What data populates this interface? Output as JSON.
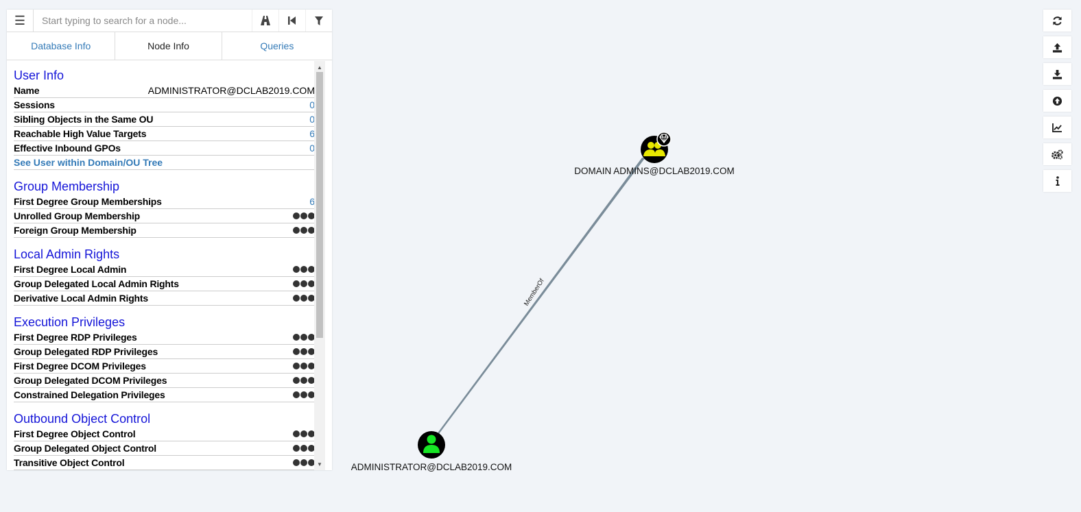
{
  "search": {
    "placeholder": "Start typing to search for a node...",
    "menu_icon": "hamburger-icon"
  },
  "search_buttons": [
    "pathfinding-icon",
    "back-icon",
    "filter-icon"
  ],
  "tabs": [
    {
      "label": "Database Info",
      "active": false
    },
    {
      "label": "Node Info",
      "active": true
    },
    {
      "label": "Queries",
      "active": false
    }
  ],
  "user_info": {
    "title": "User Info",
    "name_label": "Name",
    "name_value": "ADMINISTRATOR@DCLAB2019.COM",
    "rows": [
      {
        "label": "Sessions",
        "value": "0"
      },
      {
        "label": "Sibling Objects in the Same OU",
        "value": "0"
      },
      {
        "label": "Reachable High Value Targets",
        "value": "6"
      },
      {
        "label": "Effective Inbound GPOs",
        "value": "0"
      }
    ],
    "tree_link": "See User within Domain/OU Tree"
  },
  "group_membership": {
    "title": "Group Membership",
    "first_degree": {
      "label": "First Degree Group Memberships",
      "value": "6"
    },
    "rows": [
      "Unrolled Group Membership",
      "Foreign Group Membership"
    ]
  },
  "local_admin": {
    "title": "Local Admin Rights",
    "rows": [
      "First Degree Local Admin",
      "Group Delegated Local Admin Rights",
      "Derivative Local Admin Rights"
    ]
  },
  "execution": {
    "title": "Execution Privileges",
    "rows": [
      "First Degree RDP Privileges",
      "Group Delegated RDP Privileges",
      "First Degree DCOM Privileges",
      "Group Delegated DCOM Privileges",
      "Constrained Delegation Privileges"
    ]
  },
  "outbound": {
    "title": "Outbound Object Control",
    "rows": [
      "First Degree Object Control",
      "Group Delegated Object Control",
      "Transitive Object Control"
    ]
  },
  "toolbar": [
    "refresh-icon",
    "upload-icon",
    "download-icon",
    "upload-circle-icon",
    "chart-icon",
    "settings-icon",
    "info-icon"
  ],
  "graph": {
    "group_node": {
      "label": "DOMAIN ADMINS@DCLAB2019.COM",
      "color": "#e8e800"
    },
    "user_node": {
      "label": "ADMINISTRATOR@DCLAB2019.COM",
      "color": "#17e625"
    },
    "edge": {
      "label": "MemberOf",
      "color": "#7a8c99"
    }
  }
}
